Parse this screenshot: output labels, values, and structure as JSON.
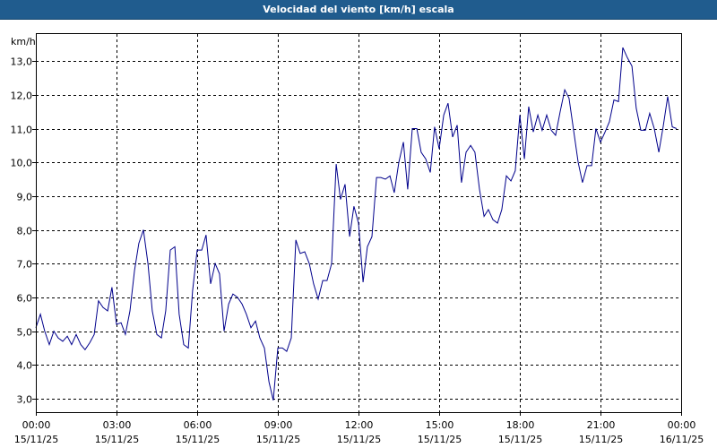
{
  "window": {
    "title": "Velocidad del viento [km/h] escala"
  },
  "colors": {
    "title_bar": "#205c8e",
    "series_line": "#00008b",
    "grid": "#000000",
    "background": "#ffffff"
  },
  "chart_data": {
    "type": "line",
    "title": "Velocidad del viento [km/h] escala",
    "unit_label": "km/h",
    "xlabel": "",
    "ylabel": "km/h",
    "ylim": [
      2.6,
      13.8
    ],
    "xlim": [
      0,
      24
    ],
    "grid": true,
    "legend": "none",
    "y_ticks": [
      {
        "value": 3,
        "label": "3,0"
      },
      {
        "value": 4,
        "label": "4,0"
      },
      {
        "value": 5,
        "label": "5,0"
      },
      {
        "value": 6,
        "label": "6,0"
      },
      {
        "value": 7,
        "label": "7,0"
      },
      {
        "value": 8,
        "label": "8,0"
      },
      {
        "value": 9,
        "label": "9,0"
      },
      {
        "value": 10,
        "label": "10,0"
      },
      {
        "value": 11,
        "label": "11,0"
      },
      {
        "value": 12,
        "label": "12,0"
      },
      {
        "value": 13,
        "label": "13,0"
      }
    ],
    "x_ticks": [
      {
        "value": 0,
        "time": "00:00",
        "date": "15/11/25"
      },
      {
        "value": 3,
        "time": "03:00",
        "date": "15/11/25"
      },
      {
        "value": 6,
        "time": "06:00",
        "date": "15/11/25"
      },
      {
        "value": 9,
        "time": "09:00",
        "date": "15/11/25"
      },
      {
        "value": 12,
        "time": "12:00",
        "date": "15/11/25"
      },
      {
        "value": 15,
        "time": "15:00",
        "date": "15/11/25"
      },
      {
        "value": 18,
        "time": "18:00",
        "date": "15/11/25"
      },
      {
        "value": 21,
        "time": "21:00",
        "date": "15/11/25"
      },
      {
        "value": 24,
        "time": "00:00",
        "date": "16/11/25"
      }
    ],
    "series": [
      {
        "x_unit": "hours since 15/11/25 00:00",
        "points": [
          [
            0.0,
            5.1
          ],
          [
            0.17,
            5.5
          ],
          [
            0.33,
            5.0
          ],
          [
            0.5,
            4.6
          ],
          [
            0.67,
            5.0
          ],
          [
            0.83,
            4.8
          ],
          [
            1.0,
            4.7
          ],
          [
            1.17,
            4.85
          ],
          [
            1.33,
            4.6
          ],
          [
            1.5,
            4.9
          ],
          [
            1.67,
            4.6
          ],
          [
            1.83,
            4.45
          ],
          [
            2.0,
            4.65
          ],
          [
            2.17,
            4.9
          ],
          [
            2.33,
            5.9
          ],
          [
            2.5,
            5.7
          ],
          [
            2.67,
            5.6
          ],
          [
            2.83,
            6.3
          ],
          [
            3.0,
            5.2
          ],
          [
            3.17,
            5.25
          ],
          [
            3.33,
            4.9
          ],
          [
            3.5,
            5.6
          ],
          [
            3.67,
            6.8
          ],
          [
            3.83,
            7.6
          ],
          [
            4.0,
            8.0
          ],
          [
            4.17,
            7.0
          ],
          [
            4.33,
            5.6
          ],
          [
            4.5,
            4.9
          ],
          [
            4.67,
            4.8
          ],
          [
            4.83,
            5.6
          ],
          [
            5.0,
            7.4
          ],
          [
            5.17,
            7.5
          ],
          [
            5.33,
            5.5
          ],
          [
            5.5,
            4.6
          ],
          [
            5.67,
            4.5
          ],
          [
            5.83,
            6.2
          ],
          [
            6.0,
            7.4
          ],
          [
            6.17,
            7.4
          ],
          [
            6.33,
            7.85
          ],
          [
            6.5,
            6.4
          ],
          [
            6.67,
            7.0
          ],
          [
            6.83,
            6.7
          ],
          [
            7.0,
            5.0
          ],
          [
            7.17,
            5.8
          ],
          [
            7.33,
            6.1
          ],
          [
            7.5,
            6.0
          ],
          [
            7.67,
            5.8
          ],
          [
            7.83,
            5.5
          ],
          [
            8.0,
            5.1
          ],
          [
            8.17,
            5.3
          ],
          [
            8.33,
            4.8
          ],
          [
            8.5,
            4.5
          ],
          [
            8.67,
            3.5
          ],
          [
            8.83,
            2.95
          ],
          [
            9.0,
            4.5
          ],
          [
            9.17,
            4.5
          ],
          [
            9.33,
            4.4
          ],
          [
            9.5,
            4.8
          ],
          [
            9.67,
            7.7
          ],
          [
            9.83,
            7.3
          ],
          [
            10.0,
            7.35
          ],
          [
            10.17,
            7.0
          ],
          [
            10.33,
            6.4
          ],
          [
            10.5,
            5.95
          ],
          [
            10.67,
            6.5
          ],
          [
            10.83,
            6.5
          ],
          [
            11.0,
            7.0
          ],
          [
            11.17,
            9.95
          ],
          [
            11.33,
            8.9
          ],
          [
            11.5,
            9.35
          ],
          [
            11.67,
            7.8
          ],
          [
            11.83,
            8.7
          ],
          [
            12.0,
            8.2
          ],
          [
            12.17,
            6.45
          ],
          [
            12.33,
            7.5
          ],
          [
            12.5,
            7.8
          ],
          [
            12.67,
            9.55
          ],
          [
            12.83,
            9.55
          ],
          [
            13.0,
            9.5
          ],
          [
            13.17,
            9.6
          ],
          [
            13.33,
            9.1
          ],
          [
            13.5,
            10.0
          ],
          [
            13.67,
            10.6
          ],
          [
            13.83,
            9.2
          ],
          [
            14.0,
            11.0
          ],
          [
            14.17,
            11.0
          ],
          [
            14.33,
            10.3
          ],
          [
            14.5,
            10.1
          ],
          [
            14.67,
            9.7
          ],
          [
            14.83,
            11.05
          ],
          [
            15.0,
            10.4
          ],
          [
            15.17,
            11.4
          ],
          [
            15.33,
            11.75
          ],
          [
            15.5,
            10.75
          ],
          [
            15.67,
            11.1
          ],
          [
            15.83,
            9.4
          ],
          [
            16.0,
            10.3
          ],
          [
            16.17,
            10.5
          ],
          [
            16.33,
            10.3
          ],
          [
            16.5,
            9.2
          ],
          [
            16.67,
            8.4
          ],
          [
            16.83,
            8.6
          ],
          [
            17.0,
            8.3
          ],
          [
            17.17,
            8.2
          ],
          [
            17.33,
            8.6
          ],
          [
            17.5,
            9.6
          ],
          [
            17.67,
            9.45
          ],
          [
            17.83,
            9.75
          ],
          [
            18.0,
            11.4
          ],
          [
            18.17,
            10.1
          ],
          [
            18.33,
            11.65
          ],
          [
            18.5,
            10.9
          ],
          [
            18.67,
            11.4
          ],
          [
            18.83,
            10.95
          ],
          [
            19.0,
            11.4
          ],
          [
            19.17,
            10.95
          ],
          [
            19.33,
            10.8
          ],
          [
            19.5,
            11.5
          ],
          [
            19.67,
            12.15
          ],
          [
            19.83,
            11.9
          ],
          [
            20.0,
            10.95
          ],
          [
            20.17,
            10.0
          ],
          [
            20.33,
            9.4
          ],
          [
            20.5,
            9.9
          ],
          [
            20.67,
            9.9
          ],
          [
            20.83,
            11.0
          ],
          [
            21.0,
            10.6
          ],
          [
            21.17,
            10.9
          ],
          [
            21.33,
            11.2
          ],
          [
            21.5,
            11.85
          ],
          [
            21.67,
            11.8
          ],
          [
            21.83,
            13.4
          ],
          [
            22.0,
            13.1
          ],
          [
            22.17,
            12.85
          ],
          [
            22.33,
            11.6
          ],
          [
            22.5,
            10.95
          ],
          [
            22.67,
            10.95
          ],
          [
            22.83,
            11.45
          ],
          [
            23.0,
            11.0
          ],
          [
            23.17,
            10.3
          ],
          [
            23.33,
            11.05
          ],
          [
            23.5,
            11.95
          ],
          [
            23.67,
            11.05
          ],
          [
            23.83,
            11.0
          ]
        ]
      }
    ]
  }
}
